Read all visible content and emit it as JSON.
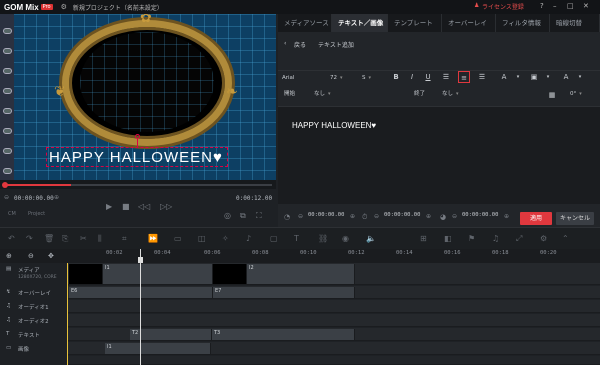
{
  "titlebar": {
    "logo": "GOM Mix",
    "logo_badge": "Pro",
    "project_title": "新規プロジェクト（名前未設定）",
    "license": "ライセンス登録",
    "icons": [
      "gear-icon",
      "help-icon",
      "minimize-icon",
      "maximize-icon",
      "close-icon"
    ]
  },
  "preview": {
    "overlay_text": "HAPPY HALLOWEEN♥",
    "current_time": "00:00:00.00",
    "total_time": "0:00:12.00",
    "progress": 0.25,
    "mode_tabs": [
      "CM",
      "Project"
    ]
  },
  "right_panel": {
    "tabs": [
      "メディアソース",
      "テキスト／画像",
      "テンプレート",
      "オーバーレイ",
      "フィルタ情報",
      "暗線切替"
    ],
    "active_tab": 1,
    "back_label": "戻る",
    "section_title": "テキスト追加",
    "font": "Arial",
    "font_size": "72",
    "style_s": "S",
    "bold": "B",
    "italic": "I",
    "underline": "U",
    "row2": {
      "start_label": "開始",
      "start_value": "なし",
      "end_label": "終了",
      "end_value": "なし",
      "extra_value": "0°"
    },
    "editor_text": "HAPPY HALLOWEEN♥",
    "time_start": "00:00:00.00",
    "time_mid": "00:00:00.00",
    "time_end": "00:00:00.00",
    "apply": "適用",
    "cancel": "キャンセル"
  },
  "timeline": {
    "ruler": [
      "00:02",
      "00:04",
      "00:06",
      "00:08",
      "00:10",
      "00:12",
      "00:14",
      "00:16",
      "00:18",
      "00:20"
    ],
    "tracks": [
      {
        "label": "メディア",
        "sub": "1280X720, CORE"
      },
      {
        "label": "オーバーレイ"
      },
      {
        "label": "オーディオ1"
      },
      {
        "label": "オーディオ2"
      },
      {
        "label": "テキスト"
      },
      {
        "label": "画像"
      }
    ],
    "clips": {
      "media_1": "I1",
      "media_2": "I2",
      "overlay_1": "E6",
      "overlay_2": "E7",
      "text_1": "T2",
      "text_2": "T3",
      "image_1": "I1"
    }
  }
}
